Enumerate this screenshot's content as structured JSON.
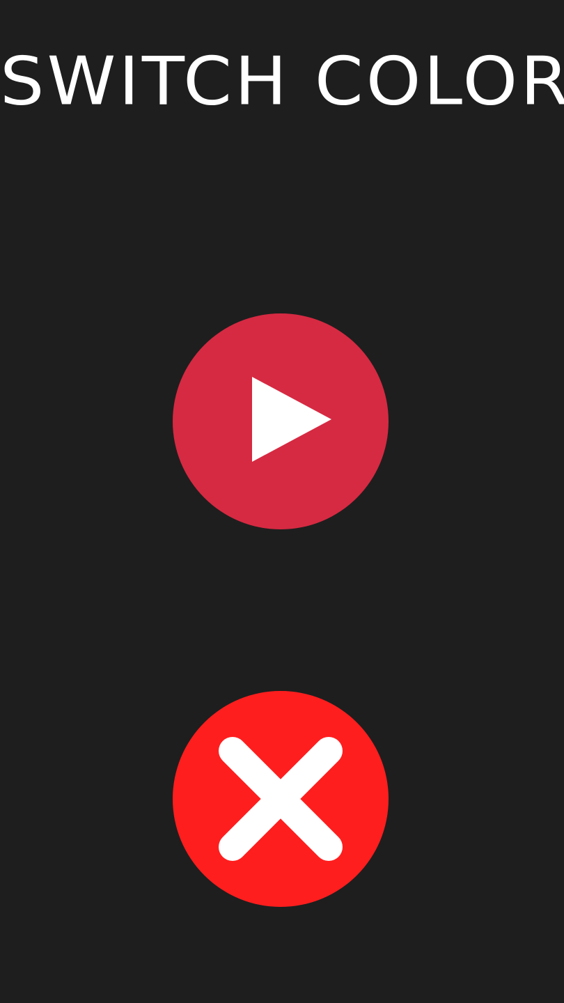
{
  "title": "SWITCH COLOR",
  "colors": {
    "background": "#1e1e1e",
    "title_text": "#ffffff",
    "play_button": "#d62a42",
    "close_button": "#ff1e1e",
    "icon": "#ffffff"
  },
  "buttons": {
    "play": {
      "icon": "play-icon"
    },
    "close": {
      "icon": "close-icon"
    }
  }
}
